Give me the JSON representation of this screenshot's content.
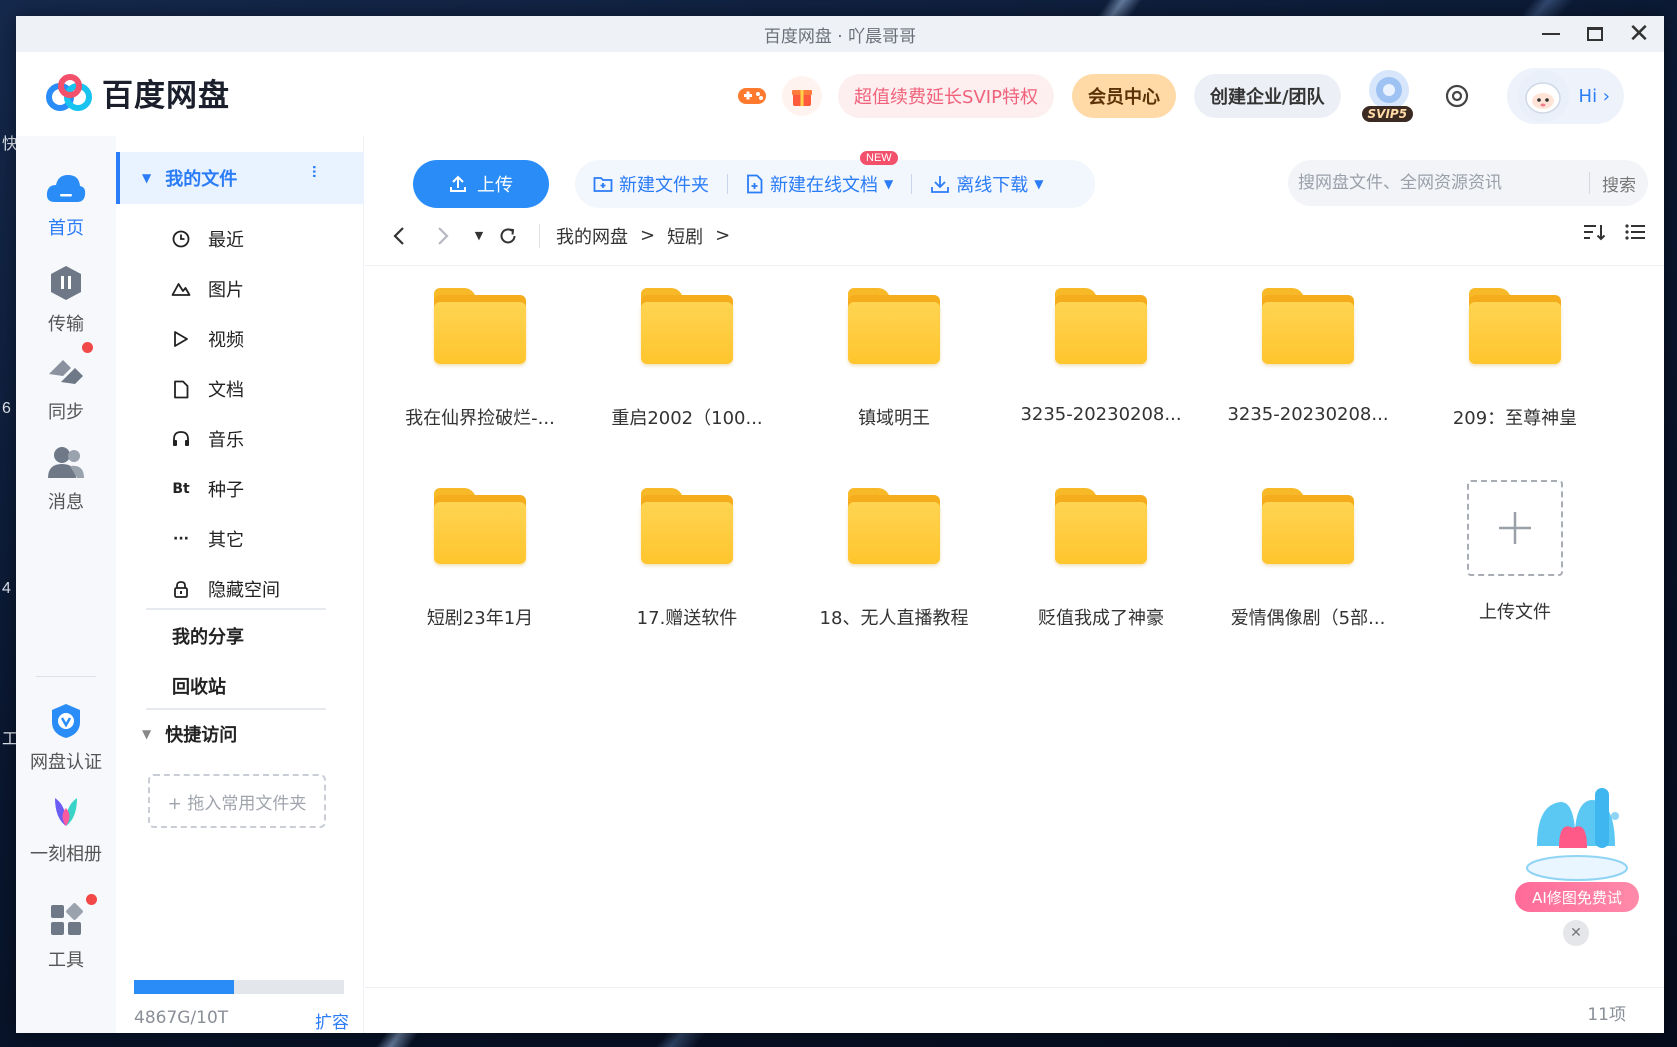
{
  "window": {
    "title": "百度网盘 · 吖晨哥哥"
  },
  "header": {
    "logo_text": "百度网盘",
    "promo_label": "超值续费延长SVIP特权",
    "vip_center_label": "会员中心",
    "team_label": "创建企业/团队",
    "svip_badge": "SVIP5",
    "hi_label": "Hi ›"
  },
  "nav": {
    "items": [
      {
        "label": "首页",
        "icon": "cloud-icon"
      },
      {
        "label": "传输",
        "icon": "transfer-icon"
      },
      {
        "label": "同步",
        "icon": "sync-icon"
      },
      {
        "label": "消息",
        "icon": "message-icon"
      },
      {
        "label": "网盘认证",
        "icon": "verify-icon"
      },
      {
        "label": "一刻相册",
        "icon": "album-icon"
      },
      {
        "label": "工具",
        "icon": "tools-icon"
      }
    ]
  },
  "sidebar": {
    "my_files": "我的文件",
    "items": [
      {
        "label": "最近",
        "icon": "clock-icon"
      },
      {
        "label": "图片",
        "icon": "image-icon"
      },
      {
        "label": "视频",
        "icon": "play-icon"
      },
      {
        "label": "文档",
        "icon": "document-icon"
      },
      {
        "label": "音乐",
        "icon": "headphones-icon"
      },
      {
        "label": "种子",
        "icon": "bt-icon",
        "glyph": "Bt"
      },
      {
        "label": "其它",
        "icon": "more-dots-icon"
      },
      {
        "label": "隐藏空间",
        "icon": "lock-icon"
      }
    ],
    "my_share": "我的分享",
    "recycle_bin": "回收站",
    "quick_access": "快捷访问",
    "drop_hint": "+ 拖入常用文件夹",
    "quota_text": "4867G/10T",
    "quota_used_fraction": 0.475,
    "expand_label": "扩容"
  },
  "toolbar": {
    "upload_label": "上传",
    "new_folder_label": "新建文件夹",
    "new_doc_label": "新建在线文档",
    "new_badge": "NEW",
    "offline_download_label": "离线下载",
    "search_placeholder": "搜网盘文件、全网资源资讯",
    "search_button": "搜索"
  },
  "breadcrumb": {
    "items": [
      "我的网盘",
      "短剧"
    ]
  },
  "files": [
    {
      "name": "我在仙界捡破烂-..."
    },
    {
      "name": "重启2002（100..."
    },
    {
      "name": "镇域明王"
    },
    {
      "name": "3235-20230208..."
    },
    {
      "name": "3235-20230208..."
    },
    {
      "name": "209：至尊神皇"
    },
    {
      "name": "短剧23年1月"
    },
    {
      "name": "17.赠送软件"
    },
    {
      "name": "18、无人直播教程"
    },
    {
      "name": "贬值我成了神豪"
    },
    {
      "name": "爱情偶像剧（5部..."
    }
  ],
  "upload_tile_label": "上传文件",
  "ai_widget_label": "AI修图免费试",
  "status": {
    "item_count": "11项"
  },
  "colors": {
    "accent": "#2a7cf7",
    "folder": "#ffc52d",
    "badge_red": "#f24848"
  }
}
